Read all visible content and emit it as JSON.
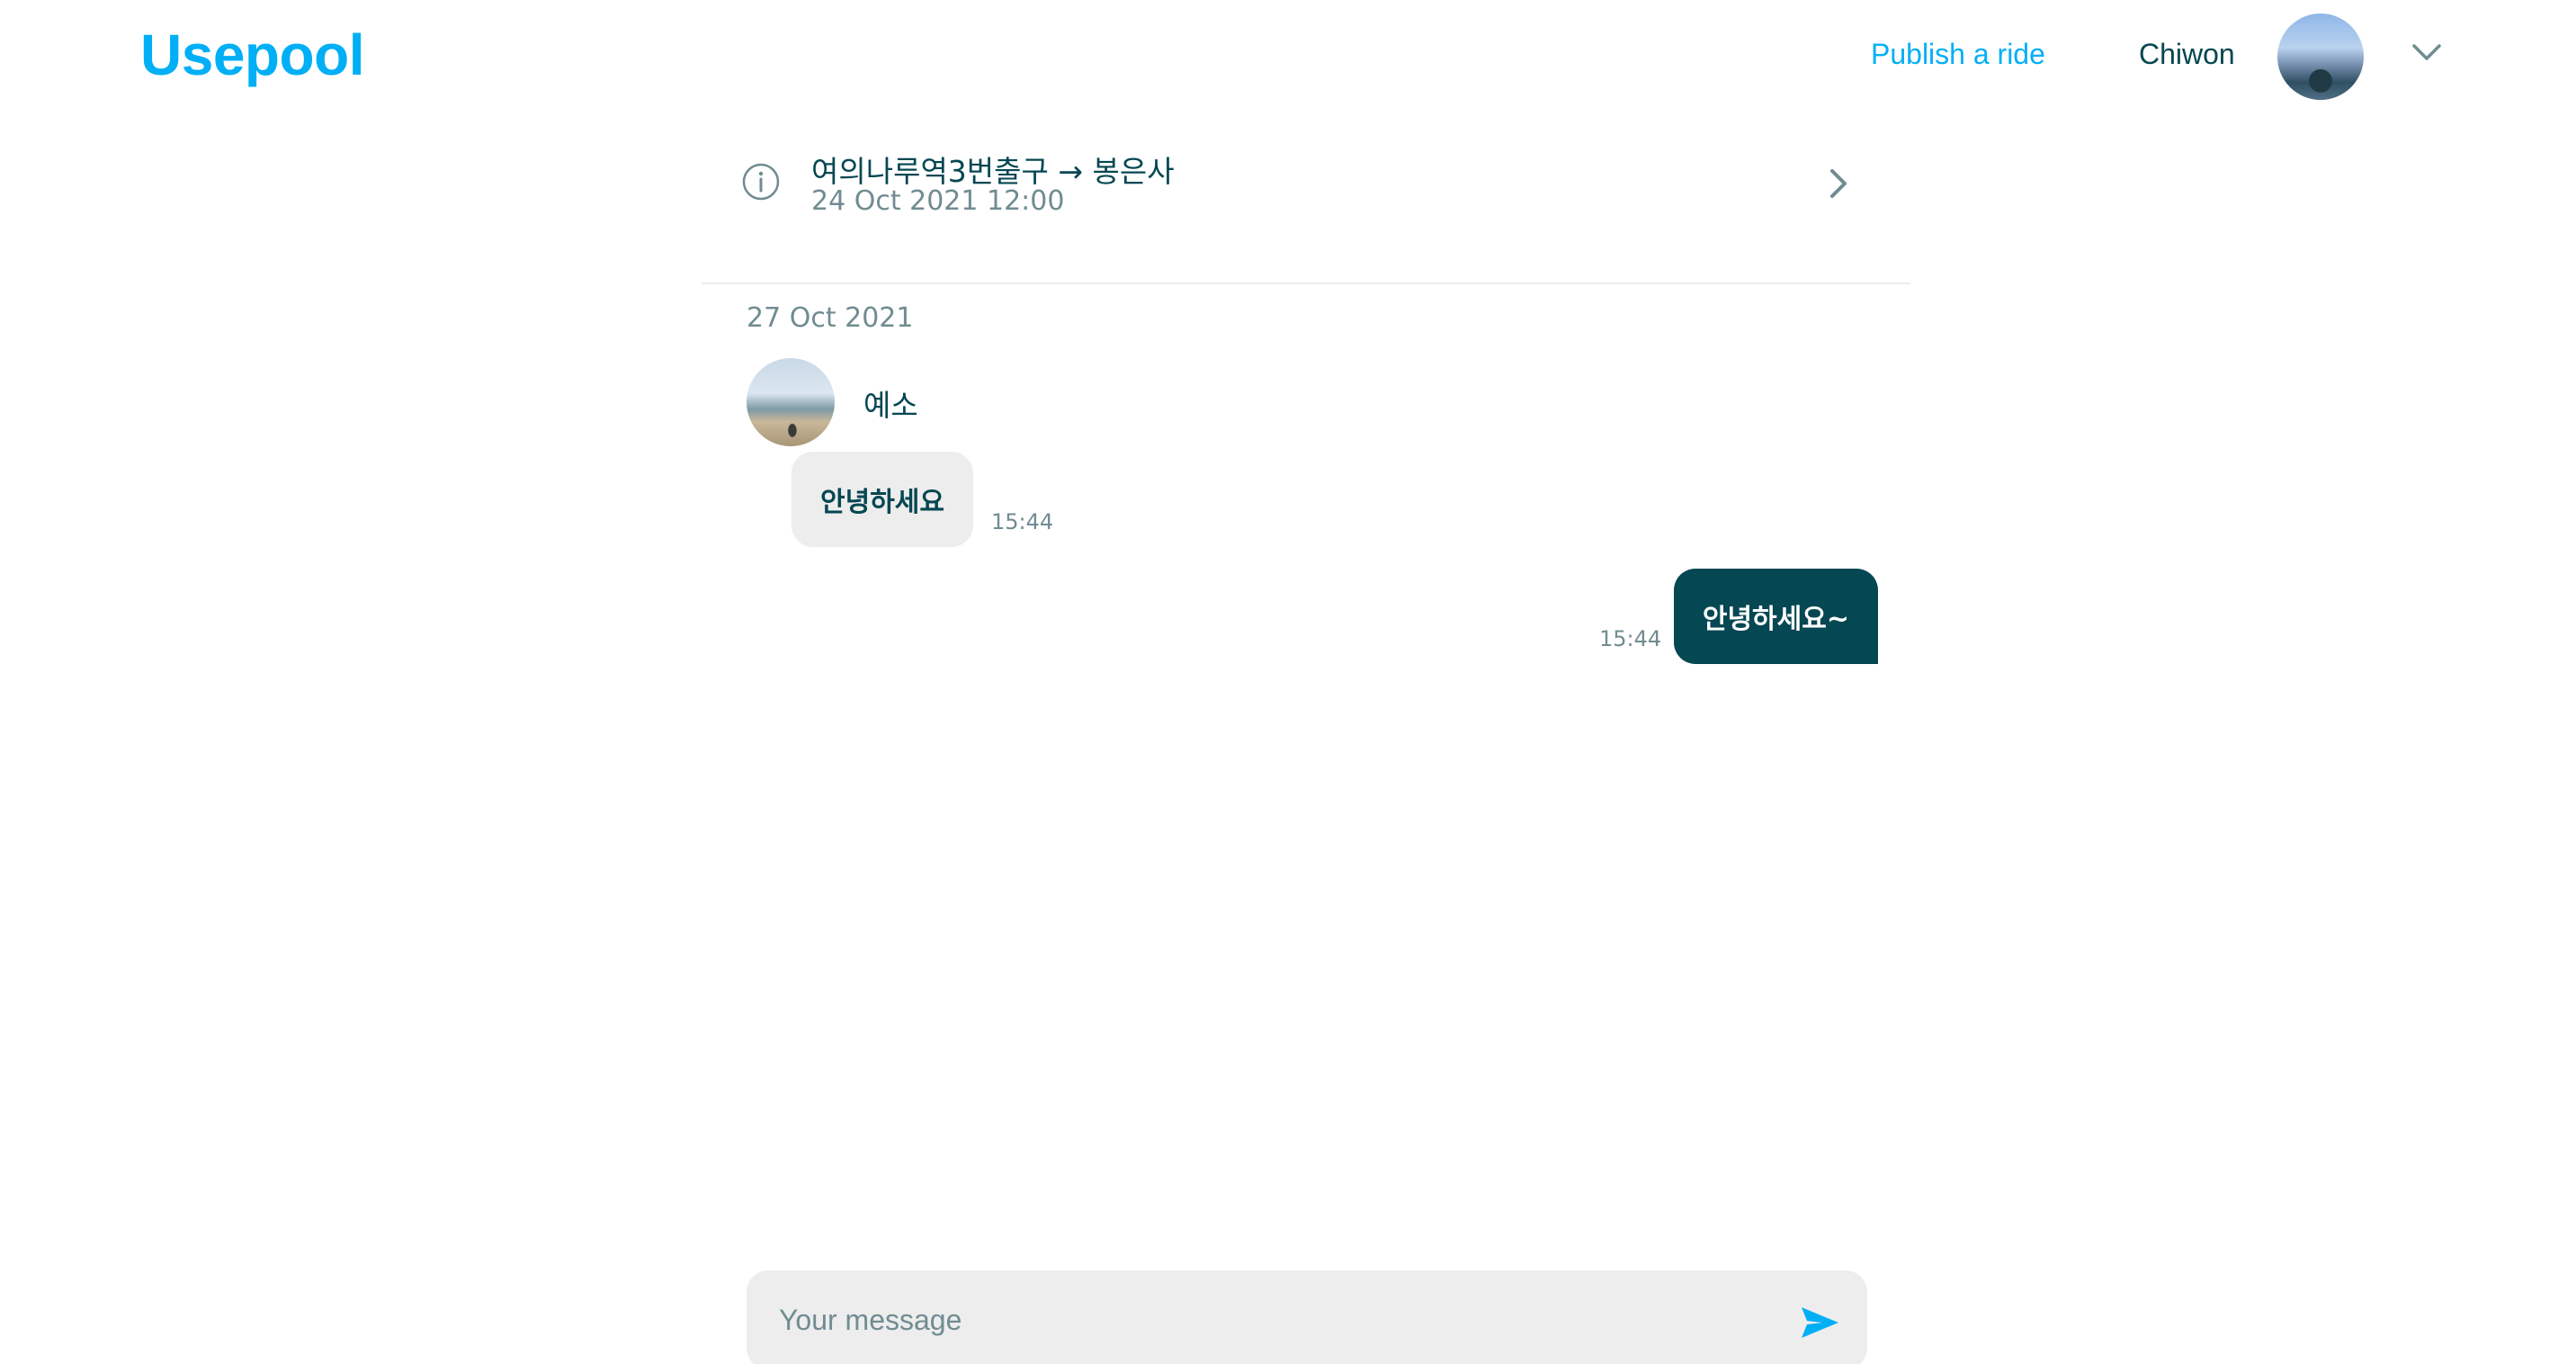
{
  "header": {
    "logo": "Usepool",
    "publish_label": "Publish a ride",
    "username": "Chiwon"
  },
  "ride": {
    "route": "여의나루역3번출구 → 봉은사",
    "datetime": "24 Oct 2021 12:00"
  },
  "conversation": {
    "date": "27 Oct 2021",
    "messages": [
      {
        "sender": "예소",
        "text": "안녕하세요",
        "time": "15:44",
        "direction": "incoming"
      },
      {
        "text": "안녕하세요~",
        "time": "15:44",
        "direction": "outgoing"
      }
    ]
  },
  "composer": {
    "placeholder": "Your message",
    "value": ""
  },
  "colors": {
    "brand": "#00aff5",
    "text_primary": "#054752",
    "text_secondary": "#708c91",
    "bubble_in": "#ededed",
    "bubble_out": "#054752"
  },
  "icons": [
    "info-icon",
    "chevron-right-icon",
    "chevron-down-icon",
    "send-icon"
  ]
}
